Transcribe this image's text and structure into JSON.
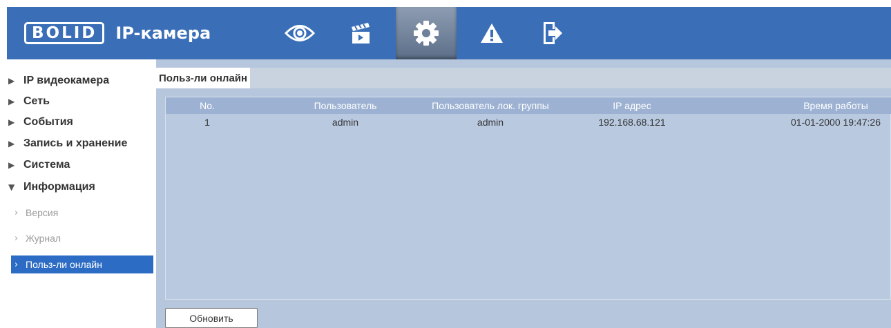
{
  "header": {
    "logo": "BOLID",
    "title": "IP-камера",
    "nav": [
      {
        "icon": "eye-icon",
        "active": false
      },
      {
        "icon": "clapperboard-icon",
        "active": false
      },
      {
        "icon": "gear-icon",
        "active": true
      },
      {
        "icon": "warning-icon",
        "active": false
      },
      {
        "icon": "logout-icon",
        "active": false
      }
    ]
  },
  "sidebar": {
    "items": [
      {
        "label": "IP видеокамера",
        "expanded": false
      },
      {
        "label": "Сеть",
        "expanded": false
      },
      {
        "label": "События",
        "expanded": false
      },
      {
        "label": "Запись и хранение",
        "expanded": false
      },
      {
        "label": "Система",
        "expanded": false
      },
      {
        "label": "Информация",
        "expanded": true
      }
    ],
    "subitems": [
      {
        "label": "Версия",
        "active": false
      },
      {
        "label": "Журнал",
        "active": false
      },
      {
        "label": "Польз-ли онлайн",
        "active": true
      }
    ],
    "collapsed_glyph": "▶",
    "expanded_glyph": "▼",
    "sub_glyph": "›"
  },
  "content": {
    "tab": "Польз-ли онлайн",
    "columns": [
      "No.",
      "Пользователь",
      "Пользователь лок. группы",
      "IP адрес",
      "Время работы"
    ],
    "rows": [
      [
        "1",
        "admin",
        "admin",
        "192.168.68.121",
        "01-01-2000 19:47:26"
      ]
    ],
    "refresh_label": "Обновить"
  },
  "colors": {
    "header_bg": "#3a6fb8",
    "content_bg": "#b6c6dd",
    "table_header_bg": "#9db2d3",
    "active_item_bg": "#2d6cc4"
  }
}
